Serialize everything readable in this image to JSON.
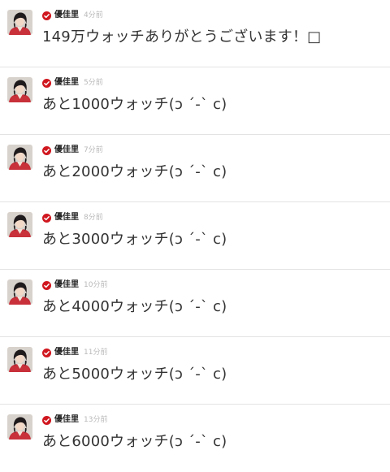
{
  "colors": {
    "verified": "#d0171f",
    "avatar_bg": "#c8303a",
    "text": "#333333",
    "time": "#b9b9b9",
    "divider": "#e3e3e3"
  },
  "posts": [
    {
      "avatar_icon": "user-avatar-icon",
      "verified_icon": "verified-check-icon",
      "author": "優佳里",
      "time": "4分前",
      "message": "149万ウォッチありがとうございます！□"
    },
    {
      "avatar_icon": "user-avatar-icon",
      "verified_icon": "verified-check-icon",
      "author": "優佳里",
      "time": "5分前",
      "message": "あと1000ウォッチ(ɔ ˊ-ˋ c)"
    },
    {
      "avatar_icon": "user-avatar-icon",
      "verified_icon": "verified-check-icon",
      "author": "優佳里",
      "time": "7分前",
      "message": "あと2000ウォッチ(ɔ ˊ-ˋ c)"
    },
    {
      "avatar_icon": "user-avatar-icon",
      "verified_icon": "verified-check-icon",
      "author": "優佳里",
      "time": "8分前",
      "message": "あと3000ウォッチ(ɔ ˊ-ˋ c)"
    },
    {
      "avatar_icon": "user-avatar-icon",
      "verified_icon": "verified-check-icon",
      "author": "優佳里",
      "time": "10分前",
      "message": "あと4000ウォッチ(ɔ ˊ-ˋ c)"
    },
    {
      "avatar_icon": "user-avatar-icon",
      "verified_icon": "verified-check-icon",
      "author": "優佳里",
      "time": "11分前",
      "message": "あと5000ウォッチ(ɔ ˊ-ˋ c)"
    },
    {
      "avatar_icon": "user-avatar-icon",
      "verified_icon": "verified-check-icon",
      "author": "優佳里",
      "time": "13分前",
      "message": "あと6000ウォッチ(ɔ ˊ-ˋ c)"
    }
  ]
}
